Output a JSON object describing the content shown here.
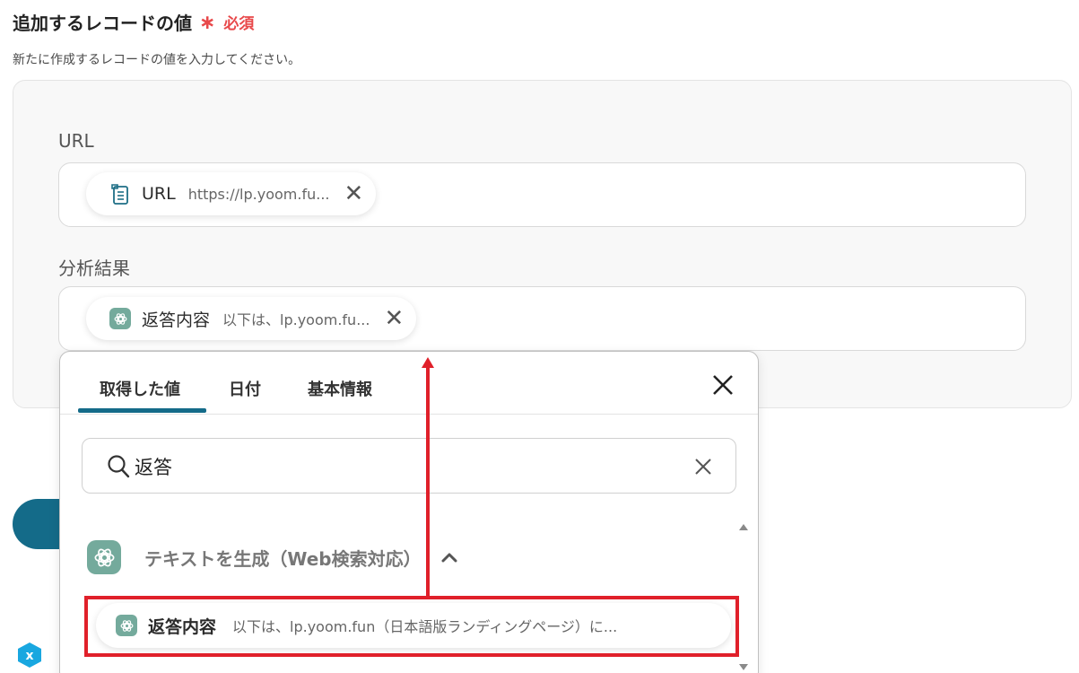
{
  "section": {
    "title": "追加するレコードの値",
    "required_mark": "∗",
    "required_label": "必須",
    "description": "新たに作成するレコードの値を入力してください。"
  },
  "fields": [
    {
      "label": "URL",
      "chip": {
        "name": "URL",
        "value": "https://lp.yoom.fu...",
        "icon": "document-icon"
      }
    },
    {
      "label": "分析結果",
      "chip": {
        "name": "返答内容",
        "value": "以下は、lp.yoom.fu...",
        "icon": "chatgpt-icon"
      }
    }
  ],
  "dropdown": {
    "tabs": [
      "取得した値",
      "日付",
      "基本情報"
    ],
    "active_tab": 0,
    "search": {
      "value": "返答",
      "placeholder": ""
    },
    "group": {
      "title": "テキストを生成（Web検索対応）",
      "expanded": true,
      "icon": "chatgpt-icon"
    },
    "result": {
      "name": "返答内容",
      "value": "以下は、lp.yoom.fun（日本語版ランディングページ）に..."
    }
  },
  "colors": {
    "accent": "#146b89",
    "required": "#e8484a",
    "highlight": "#e0202a",
    "gpt_icon_bg": "#74aa9c"
  }
}
